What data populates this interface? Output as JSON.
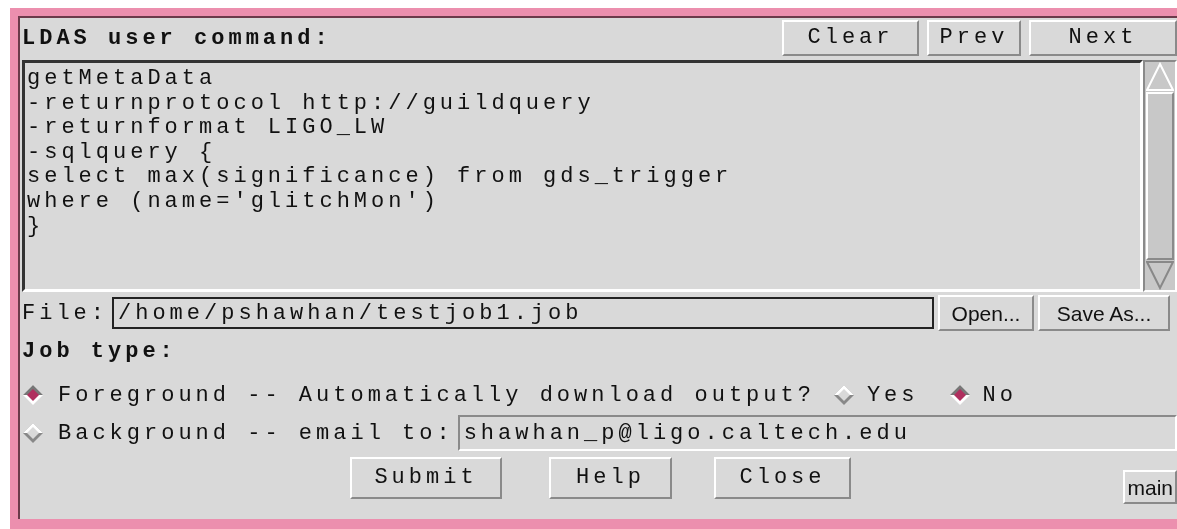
{
  "header": {
    "title": "LDAS user command:",
    "buttons": [
      "Clear",
      "Prev",
      "Next"
    ]
  },
  "command": {
    "lines": [
      "getMetaData",
      "-returnprotocol http://guildquery",
      "-returnformat LIGO_LW",
      "-sqlquery {",
      "select max(significance) from gds_trigger",
      "where (name='glitchMon')",
      "}"
    ]
  },
  "file": {
    "label": "File:",
    "value": "/home/pshawhan/testjob1.job",
    "buttons": [
      "Open...",
      "Save As..."
    ]
  },
  "job_type": {
    "label": "Job type:",
    "options": [
      {
        "kind": "download",
        "label": "Foreground -- Automatically download output?",
        "selected": true,
        "choices": [
          {
            "label": "Yes",
            "selected": false
          },
          {
            "label": "No",
            "selected": true
          }
        ]
      },
      {
        "kind": "email",
        "label": "Background -- email to:",
        "selected": false,
        "value": "shawhan_p@ligo.caltech.edu"
      }
    ]
  },
  "actions": [
    "Submit",
    "Help",
    "Close"
  ],
  "corner_button": "main"
}
